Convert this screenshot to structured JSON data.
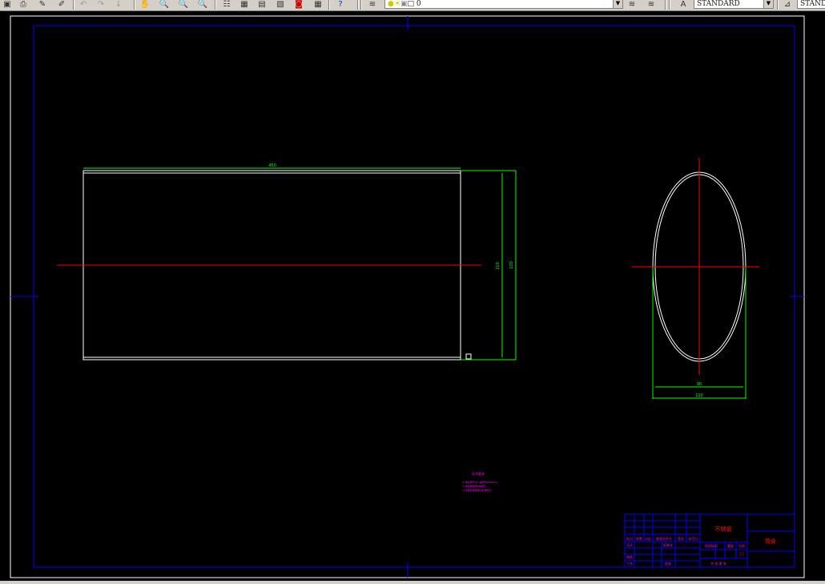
{
  "toolbar": {
    "layer_name": "0",
    "text_style": "STANDARD",
    "dim_style": "STAND"
  },
  "drawing": {
    "dim_length": "450",
    "dim_inner_height": "210",
    "dim_outer_height": "220",
    "dim_inner_width": "90",
    "dim_outer_width": "100",
    "note_title": "技术要求",
    "note_line1": "1.未注明尺寸公差按GB1804-m",
    "note_line2": "2.焊缝质量按GB规范",
    "note_line3": "3.表面处理按相关标准执行",
    "title_block_name": "不锈钢",
    "title_block_part": "筒身",
    "tb_label_mark": "标记",
    "tb_label_count": "处数",
    "tb_label_zone": "分区",
    "tb_label_docno": "更改文件号",
    "tb_label_sign": "签名",
    "tb_label_date": "年月日",
    "tb_label_design": "设计",
    "tb_label_std": "标准化",
    "tb_label_stage": "阶段标记",
    "tb_label_weight": "重量",
    "tb_label_scale": "比例",
    "tb_label_check": "审核",
    "tb_label_process": "工艺",
    "tb_label_approve": "批准",
    "tb_label_sheets": "共 张 第 张",
    "tb_scale_value": "1:1"
  }
}
